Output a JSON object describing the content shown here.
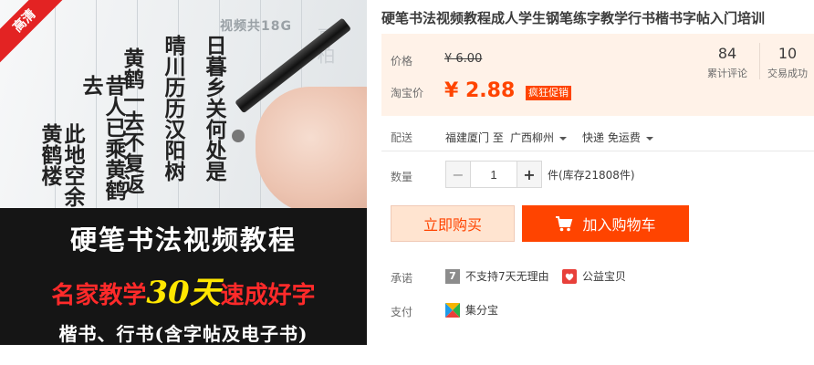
{
  "image": {
    "hd_ribbon": "高清",
    "video_badge": "视频共18G",
    "calligraphy_columns": [
      "日暮乡关何处是",
      "晴川历历汉阳树",
      "黄鹤一去不复返",
      "昔人已乘黄鹤去",
      "此地空余黄鹤楼"
    ],
    "headline": "硬笔书法视频教程",
    "slogan_part1": "名家教学",
    "slogan_highlight": "30天",
    "slogan_part2": "速成好字",
    "subline": "楷书、行书(含字帖及电子书)"
  },
  "product": {
    "title": "硬笔书法视频教程成人学生钢笔练字教学行书楷书字帖入门培训"
  },
  "price": {
    "original_label": "价格",
    "original_value": "¥ 6.00",
    "sale_label": "淘宝价",
    "sale_value": "¥ 2.88",
    "promo_tag": "疯狂促销"
  },
  "stats": [
    {
      "value": "84",
      "caption": "累计评论"
    },
    {
      "value": "10",
      "caption": "交易成功"
    }
  ],
  "delivery": {
    "label": "配送",
    "origin": "福建厦门 至",
    "destination": "广西柳州",
    "shipping": "快递 免运费"
  },
  "quantity": {
    "label": "数量",
    "value": "1",
    "minus": "−",
    "plus": "+",
    "stock": "件(库存21808件)"
  },
  "actions": {
    "buy_now": "立即购买",
    "add_to_cart": "加入购物车"
  },
  "promise": {
    "label": "承诺",
    "items": [
      {
        "icon": "seven-day-icon",
        "text": "不支持7天无理由"
      },
      {
        "icon": "charity-icon",
        "text": "公益宝贝"
      }
    ]
  },
  "payment": {
    "label": "支付",
    "items": [
      {
        "icon": "jifenbao-icon",
        "text": "集分宝"
      }
    ]
  },
  "colors": {
    "accent": "#ff4400",
    "price_bg": "#fff2e8",
    "buy_bg": "#ffe4d0"
  }
}
